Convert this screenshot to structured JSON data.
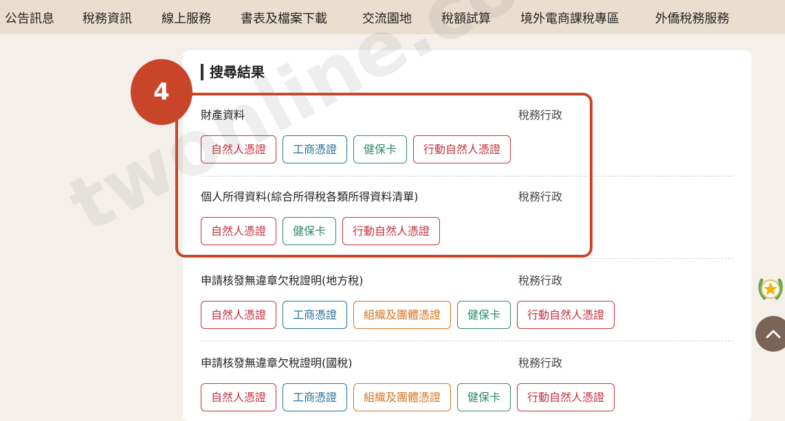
{
  "nav": {
    "items": [
      "公告訊息",
      "稅務資訊",
      "線上服務",
      "書表及檔案下載",
      "交流園地",
      "稅額試算",
      "境外電商課稅專區",
      "外僑稅務服務"
    ]
  },
  "section": {
    "title": "搜尋結果"
  },
  "step": {
    "number": "4"
  },
  "watermark": "twonline.com.w",
  "results": [
    {
      "name": "財產資料",
      "category": "稅務行政",
      "tags": [
        {
          "label": "自然人憑證",
          "color": "red"
        },
        {
          "label": "工商憑證",
          "color": "blue"
        },
        {
          "label": "健保卡",
          "color": "green"
        },
        {
          "label": "行動自然人憑證",
          "color": "red"
        }
      ]
    },
    {
      "name": "個人所得資料(綜合所得稅各類所得資料清單)",
      "category": "稅務行政",
      "tags": [
        {
          "label": "自然人憑證",
          "color": "red"
        },
        {
          "label": "健保卡",
          "color": "green"
        },
        {
          "label": "行動自然人憑證",
          "color": "red"
        }
      ]
    },
    {
      "name": "申請核發無違章欠稅證明(地方稅)",
      "category": "稅務行政",
      "tags": [
        {
          "label": "自然人憑證",
          "color": "red"
        },
        {
          "label": "工商憑證",
          "color": "blue"
        },
        {
          "label": "組織及團體憑證",
          "color": "orange"
        },
        {
          "label": "健保卡",
          "color": "green"
        },
        {
          "label": "行動自然人憑證",
          "color": "red"
        }
      ]
    },
    {
      "name": "申請核發無違章欠稅證明(國稅)",
      "category": "稅務行政",
      "tags": [
        {
          "label": "自然人憑證",
          "color": "red"
        },
        {
          "label": "工商憑證",
          "color": "blue"
        },
        {
          "label": "組織及團體憑證",
          "color": "orange"
        },
        {
          "label": "健保卡",
          "color": "green"
        },
        {
          "label": "行動自然人憑證",
          "color": "red"
        }
      ]
    }
  ],
  "colors": {
    "red": "#c4303c",
    "blue": "#2c6f9a",
    "green": "#2f8a6c",
    "orange": "#d9731f",
    "highlight": "#c9452a",
    "nav_bg": "#eadfcf"
  },
  "icons": {
    "award": "award-badge-icon",
    "scroll_top": "chevron-up-icon"
  }
}
